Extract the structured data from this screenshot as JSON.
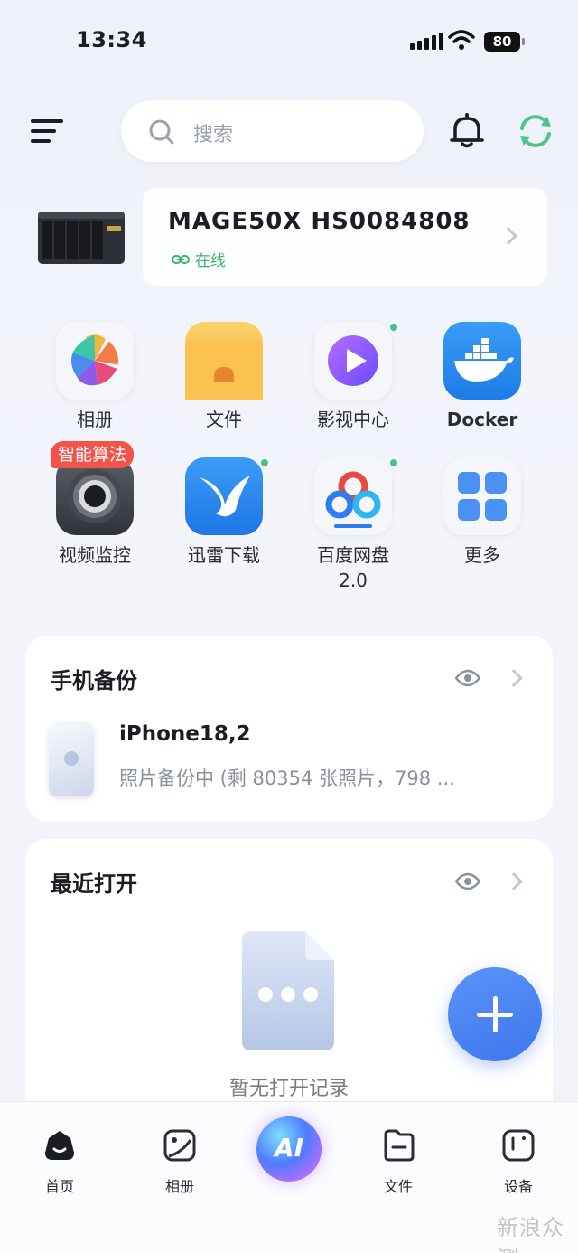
{
  "status_bar": {
    "time": "13:34",
    "battery": "80"
  },
  "header": {
    "search_placeholder": "搜索"
  },
  "device": {
    "name": "MAGE50X HS0084808",
    "status": "在线"
  },
  "apps": [
    {
      "label": "相册"
    },
    {
      "label": "文件"
    },
    {
      "label": "影视中心"
    },
    {
      "label": "Docker"
    },
    {
      "label": "视频监控",
      "badge": "智能算法"
    },
    {
      "label": "迅雷下载"
    },
    {
      "label": "百度网盘\n2.0"
    },
    {
      "label": "更多"
    }
  ],
  "backup": {
    "title": "手机备份",
    "device_name": "iPhone18,2",
    "status": "照片备份中 (剩 80354 张照片，798 ..."
  },
  "recent": {
    "title": "最近打开",
    "empty_text": "暂无打开记录"
  },
  "tabs": [
    {
      "label": "首页"
    },
    {
      "label": "相册"
    },
    {
      "label": "AI"
    },
    {
      "label": "文件"
    },
    {
      "label": "设备"
    }
  ],
  "watermark": "新浪众测",
  "colors": {
    "accent": "#3f76ee",
    "online": "#3cb371",
    "badge": "#f2544a",
    "dot": "#47c185"
  }
}
